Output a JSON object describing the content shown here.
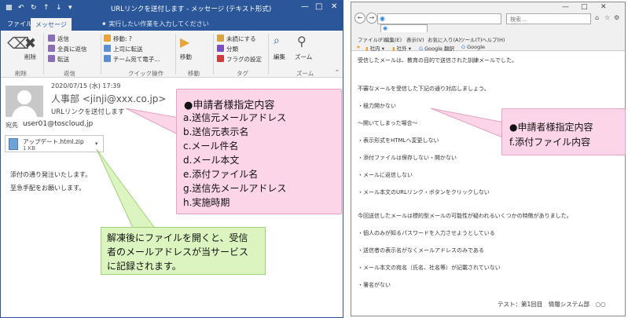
{
  "outlook": {
    "window_title": "URLリンクを送付します - メッセージ (テキスト形式)",
    "tabs": [
      "ファイル",
      "メッセージ"
    ],
    "tell_me": "実行したい作業を入力してください",
    "ribbon": {
      "delete": "削除",
      "reply": "返信",
      "reply_all": "全員に返信",
      "forward": "転送",
      "move_to": "移動: ?",
      "to_manager": "上司に転送",
      "team_email": "チーム宛て電子...",
      "move": "移動",
      "mark_unread": "未読にする",
      "categorize": "分類",
      "follow_up": "フラグの設定",
      "edit": "編集",
      "zoom": "ズーム",
      "groups": [
        "削除",
        "返信",
        "クイック操作",
        "移動",
        "タグ",
        "ズーム"
      ]
    },
    "message": {
      "date": "2020/07/15 (水) 17:39",
      "sender": "人事部 <jinji@xxx.co.jp>",
      "subject": "URLリンクを送付します",
      "to_label": "宛先",
      "to": "user01@toscloud.jp",
      "attachment_name": "アップデート.html.zip",
      "attachment_size": "1 KB",
      "body_line1": "添付の通り発注いたします。",
      "body_line2": "至急手配をお願いします。"
    }
  },
  "callout_left": {
    "title": "●申請者様指定内容",
    "items": [
      "a.送信元メールアドレス",
      "b.送信元表示名",
      "c.メール件名",
      "d.メール本文",
      "e.添付ファイル名",
      "g.送信先メールアドレス",
      "h.実施時期"
    ]
  },
  "callout_green": {
    "lines": [
      "解凍後にファイルを開くと、受信",
      "者のメールアドレスが当サービス",
      "に記録されます。"
    ]
  },
  "browser": {
    "search_placeholder": "検索...",
    "menu": [
      "ファイル(F)",
      "編集(E)",
      "表示(V)",
      "お気に入り(A)",
      "ツール(T)",
      "ヘルプ(H)"
    ],
    "favorites": [
      "社内",
      "社外",
      "Google 翻訳",
      "Google"
    ],
    "content": [
      "受信したメールは、教育の目的で送信された訓練メールでした。",
      "",
      "不審なメールを受信した下記の通り対応しましょう。",
      "・極力開かない",
      "〜開いてしまった場合〜",
      "・表示形式をHTMLへ変更しない",
      "・添付ファイルは保存しない・開かない",
      "・メールに返信しない",
      "・メール本文のURLリンク・ボタンをクリックしない",
      "",
      "今回送信したメールは標的型メールの可能性が疑われるいくつかの特徴がありました。",
      "・個人のみが知るパスワードを入力させようとしている",
      "・送信者の表示名がなくメールアドレスのみである",
      "・メール本文の宛名（氏名、社名等）が記載されていない",
      "・署名がない"
    ],
    "footer": "テスト：第1回目　情報システム部　○○"
  },
  "callout_right": {
    "title": "●申請者様指定内容",
    "item": "f.添付ファイル内容"
  },
  "colors": {
    "outlook_blue": "#2b579a",
    "callout_pink": "#fcd5e8",
    "callout_green": "#dcf5c0"
  }
}
